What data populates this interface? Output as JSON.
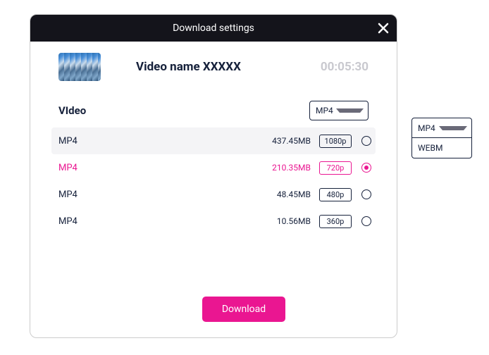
{
  "modal": {
    "title": "Download settings",
    "video_name": "Video name XXXXX",
    "duration": "00:05:30",
    "section_label": "VIdeo",
    "format_selected": "MP4",
    "rows": [
      {
        "format": "MP4",
        "size": "437.45MB",
        "res": "1080p",
        "state": "hover"
      },
      {
        "format": "MP4",
        "size": "210.35MB",
        "res": "720p",
        "state": "selected"
      },
      {
        "format": "MP4",
        "size": "48.45MB",
        "res": "480p",
        "state": ""
      },
      {
        "format": "MP4",
        "size": "10.56MB",
        "res": "360p",
        "state": ""
      }
    ],
    "download_label": "Download"
  },
  "dropdown": {
    "selected": "MP4",
    "options": [
      "WEBM"
    ]
  },
  "colors": {
    "accent": "#ea1691",
    "dark": "#16213b"
  }
}
